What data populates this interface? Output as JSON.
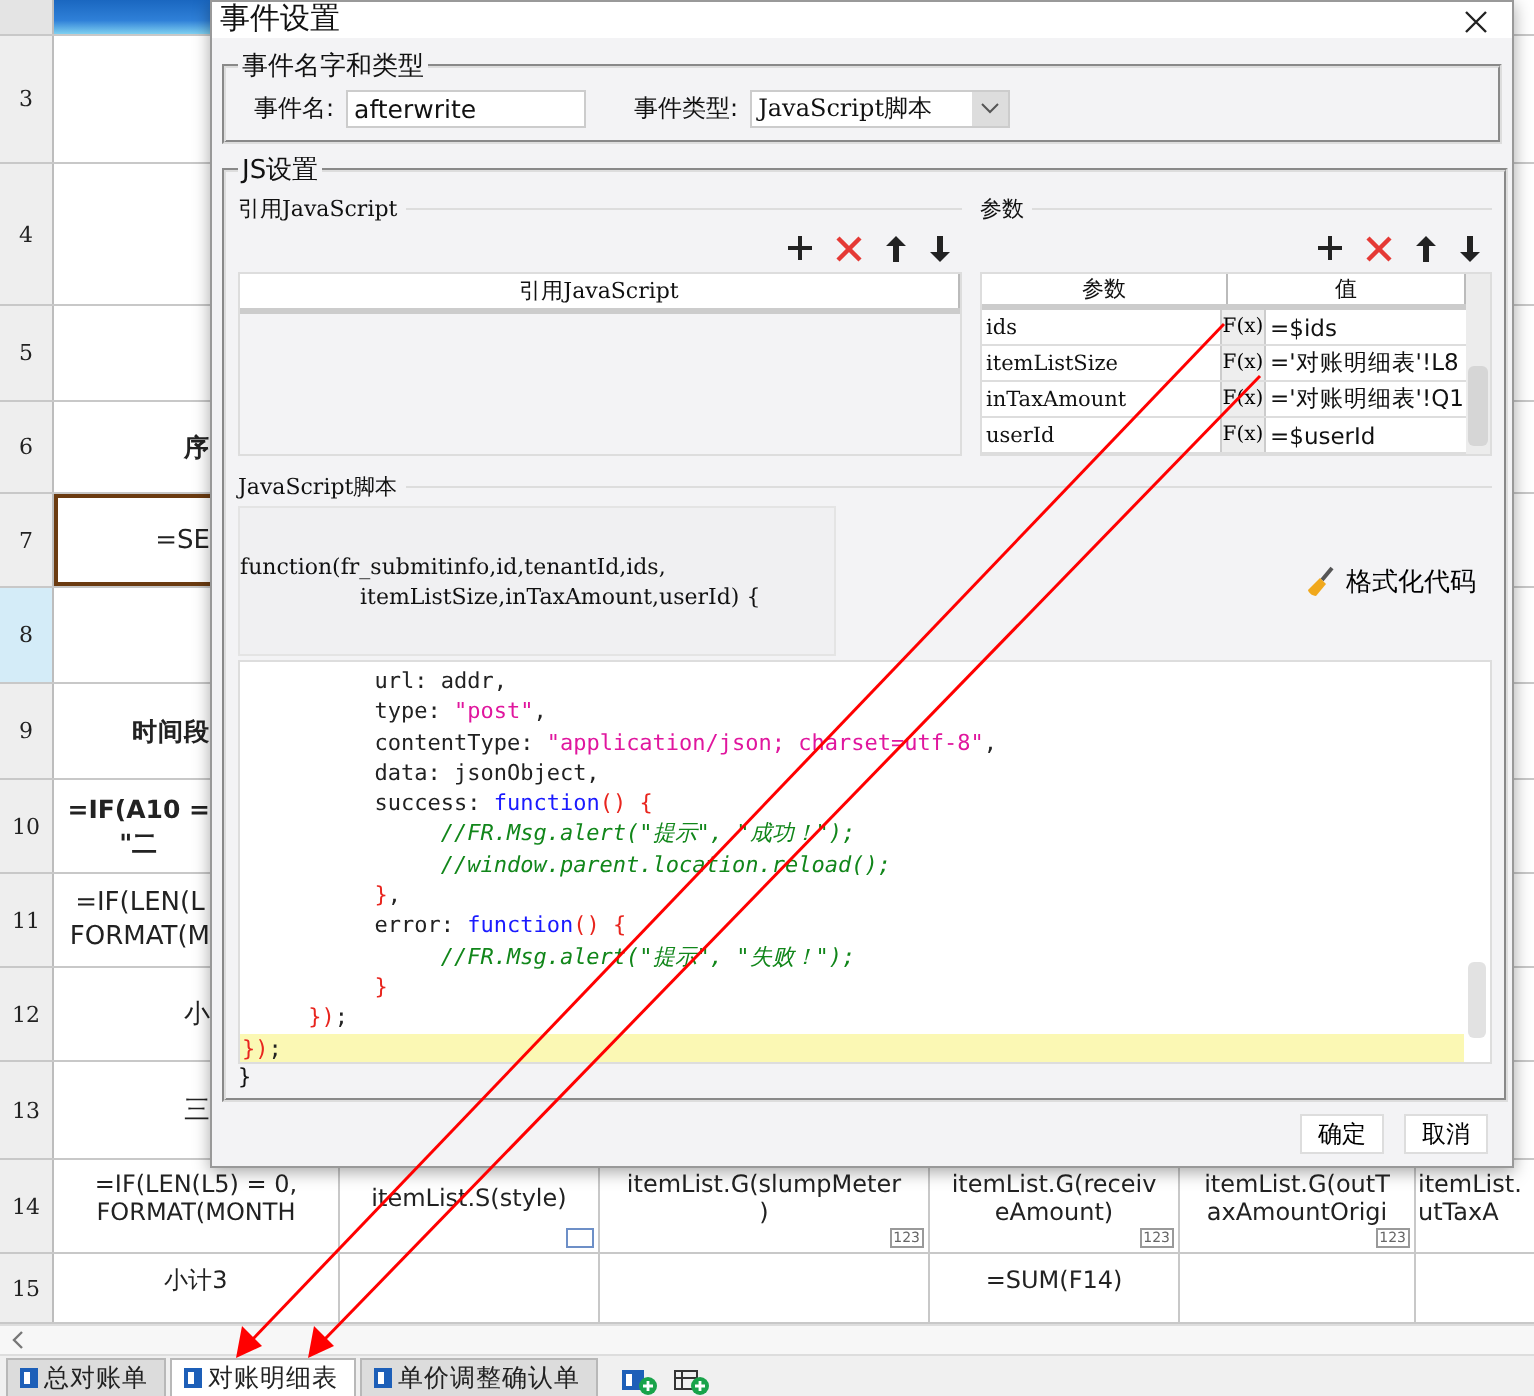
{
  "sheet": {
    "rows": [
      {
        "header": "3",
        "selected": false,
        "cells": []
      },
      {
        "header": "4",
        "selected": false,
        "cells": []
      },
      {
        "header": "5",
        "selected": false,
        "cells": []
      },
      {
        "header": "6",
        "selected": false,
        "cells": [
          {
            "lines": [
              "序"
            ],
            "bold": true
          }
        ]
      },
      {
        "header": "7",
        "selected": false,
        "cells": [
          {
            "lines": [
              "=SE"
            ],
            "bold": false
          }
        ]
      },
      {
        "header": "8",
        "selected": true,
        "cells": []
      },
      {
        "header": "9",
        "selected": false,
        "cells": [
          {
            "lines": [
              "时间段"
            ],
            "bold": true
          }
        ]
      },
      {
        "header": "10",
        "selected": false,
        "cells": [
          {
            "lines": [
              "=IF(A10 =",
              "\"二"
            ],
            "bold": true
          }
        ]
      },
      {
        "header": "11",
        "selected": false,
        "cells": [
          {
            "lines": [
              "=IF(LEN(L",
              "FORMAT(M"
            ],
            "bold": false
          }
        ]
      },
      {
        "header": "12",
        "selected": false,
        "cells": [
          {
            "lines": [
              "小"
            ],
            "bold": false
          }
        ]
      },
      {
        "header": "13",
        "selected": false,
        "cells": [
          {
            "lines": [
              "三"
            ],
            "bold": false
          }
        ]
      },
      {
        "header": "14",
        "selected": false,
        "cells": [
          {
            "lines": [
              "=IF(LEN(L5) = 0,",
              "FORMAT(MONTH"
            ],
            "bold": false
          },
          {
            "lines": [
              "itemList.S(style)"
            ],
            "bold": false,
            "badge": {
              "kind": "box"
            }
          },
          {
            "lines": [
              "itemList.G(slumpMeter",
              ")"
            ],
            "bold": false,
            "badge": {
              "kind": "number",
              "text": "123"
            }
          },
          {
            "lines": [
              "itemList.G(receiv",
              "eAmount)"
            ],
            "bold": false,
            "badge": {
              "kind": "number",
              "text": "123"
            }
          },
          {
            "lines": [
              "itemList.G(outT",
              "axAmountOrigi"
            ],
            "bold": false,
            "badge": {
              "kind": "number",
              "text": "123"
            }
          },
          {
            "lines": [
              "itemList.",
              "utTaxA"
            ],
            "bold": false
          }
        ]
      },
      {
        "header": "15",
        "selected": false,
        "cells": [
          {
            "lines": [
              "小计3"
            ],
            "bold": false
          },
          {},
          {},
          {
            "lines": [
              "=SUM(F14)"
            ],
            "bold": false
          },
          {},
          {}
        ]
      }
    ]
  },
  "dialog": {
    "title": "事件设置",
    "name_type": {
      "legend": "事件名字和类型",
      "name_label": "事件名:",
      "name_value": "afterwrite",
      "type_label": "事件类型:",
      "type_value": "JavaScript脚本"
    },
    "js": {
      "legend": "JS设置",
      "references": {
        "title": "引用JavaScript",
        "column": "引用JavaScript"
      },
      "params": {
        "title": "参数",
        "columns": [
          "参数",
          "值"
        ],
        "rows": [
          {
            "name": "ids",
            "fx": "F(x)",
            "value": "=$ids"
          },
          {
            "name": "itemListSize",
            "fx": "F(x)",
            "value": "='对账明细表'!L8"
          },
          {
            "name": "inTaxAmount",
            "fx": "F(x)",
            "value": "='对账明细表'!Q1"
          },
          {
            "name": "userId",
            "fx": "F(x)",
            "value": "=$userId"
          }
        ]
      },
      "script": {
        "title": "JavaScript脚本",
        "header": [
          "function(fr_submitinfo,id,tenantId,ids,",
          "itemListSize,inTaxAmount,userId) {"
        ],
        "format_button": "格式化代码",
        "lines": [
          {
            "highlighted": false,
            "segments": [
              {
                "kind": "plain",
                "text": "          url: addr,"
              }
            ]
          },
          {
            "highlighted": false,
            "segments": [
              {
                "kind": "plain",
                "text": "          type: "
              },
              {
                "kind": "string",
                "text": "\"post\""
              },
              {
                "kind": "plain",
                "text": ","
              }
            ]
          },
          {
            "highlighted": false,
            "segments": [
              {
                "kind": "plain",
                "text": "          contentType: "
              },
              {
                "kind": "string",
                "text": "\"application/json; charset=utf-8\""
              },
              {
                "kind": "plain",
                "text": ","
              }
            ]
          },
          {
            "highlighted": false,
            "segments": [
              {
                "kind": "plain",
                "text": "          data: jsonObject,"
              }
            ]
          },
          {
            "highlighted": false,
            "segments": [
              {
                "kind": "plain",
                "text": "          success: "
              },
              {
                "kind": "keyword",
                "text": "function"
              },
              {
                "kind": "bracket",
                "text": "() {"
              }
            ]
          },
          {
            "highlighted": false,
            "segments": [
              {
                "kind": "comment",
                "text": "               //FR.Msg.alert(\"提示\", \"成功！\");"
              }
            ]
          },
          {
            "highlighted": false,
            "segments": [
              {
                "kind": "comment",
                "text": "               //window.parent.location.reload();"
              }
            ]
          },
          {
            "highlighted": false,
            "segments": [
              {
                "kind": "bracket",
                "text": "          }"
              },
              {
                "kind": "plain",
                "text": ","
              }
            ]
          },
          {
            "highlighted": false,
            "segments": [
              {
                "kind": "plain",
                "text": "          error: "
              },
              {
                "kind": "keyword",
                "text": "function"
              },
              {
                "kind": "bracket",
                "text": "() {"
              }
            ]
          },
          {
            "highlighted": false,
            "segments": [
              {
                "kind": "comment",
                "text": "               //FR.Msg.alert(\"提示\", \"失败！\");"
              }
            ]
          },
          {
            "highlighted": false,
            "segments": [
              {
                "kind": "bracket",
                "text": "          }"
              }
            ]
          },
          {
            "highlighted": false,
            "segments": [
              {
                "kind": "bracket",
                "text": "     })"
              },
              {
                "kind": "plain",
                "text": ";"
              }
            ]
          },
          {
            "highlighted": true,
            "segments": [
              {
                "kind": "bracket",
                "text": "})"
              },
              {
                "kind": "plain",
                "text": ";"
              }
            ]
          }
        ],
        "footer": "}"
      }
    },
    "buttons": [
      "确定",
      "取消"
    ]
  },
  "tabs": [
    {
      "label": "总对账单",
      "selected": false
    },
    {
      "label": "对账明细表",
      "selected": true
    },
    {
      "label": "单价调整确认单",
      "selected": false
    }
  ]
}
